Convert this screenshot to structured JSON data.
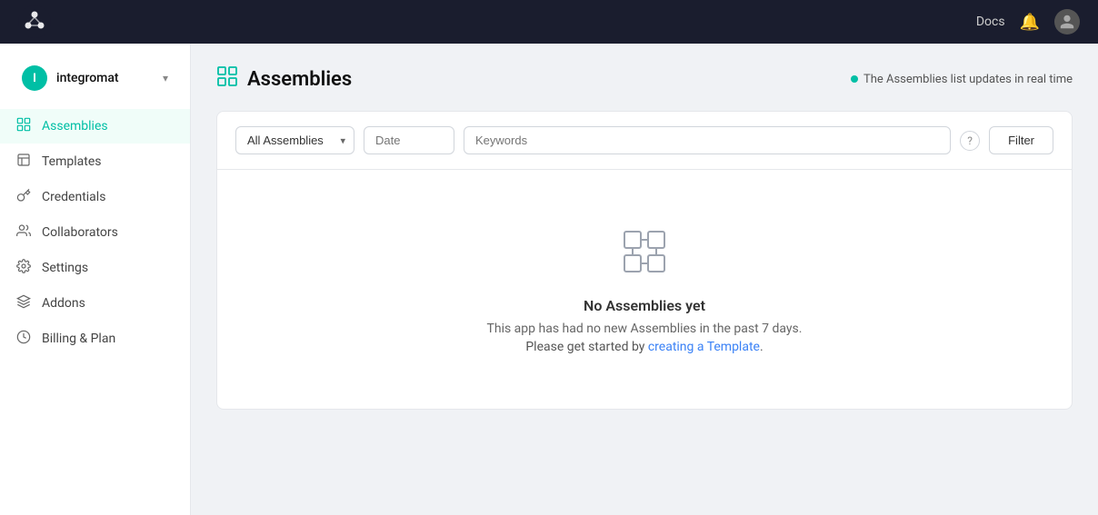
{
  "topnav": {
    "docs_label": "Docs",
    "logo_alt": "integromat-logo"
  },
  "sidebar": {
    "org": {
      "initial": "I",
      "name": "integromat",
      "chevron": "▾"
    },
    "items": [
      {
        "id": "assemblies",
        "label": "Assemblies",
        "icon": "⬡",
        "active": true
      },
      {
        "id": "templates",
        "label": "Templates",
        "icon": "☰",
        "active": false
      },
      {
        "id": "credentials",
        "label": "Credentials",
        "icon": "🔑",
        "active": false
      },
      {
        "id": "collaborators",
        "label": "Collaborators",
        "icon": "👥",
        "active": false
      },
      {
        "id": "settings",
        "label": "Settings",
        "icon": "⚙",
        "active": false
      },
      {
        "id": "addons",
        "label": "Addons",
        "icon": "◇",
        "active": false
      },
      {
        "id": "billing",
        "label": "Billing & Plan",
        "icon": "①",
        "active": false
      }
    ]
  },
  "header": {
    "title": "Assemblies",
    "realtime_text": "The Assemblies list updates in real time"
  },
  "filters": {
    "assembly_options": [
      "All Assemblies"
    ],
    "assembly_selected": "All Assemblies",
    "date_placeholder": "Date",
    "keywords_placeholder": "Keywords",
    "filter_button": "Filter",
    "help_tooltip": "?"
  },
  "empty_state": {
    "title": "No Assemblies yet",
    "description": "This app has had no new Assemblies in the past 7 days.",
    "cta_prefix": "Please get started by ",
    "cta_link_text": "creating a Template",
    "cta_suffix": ".",
    "cta_href": "#"
  }
}
